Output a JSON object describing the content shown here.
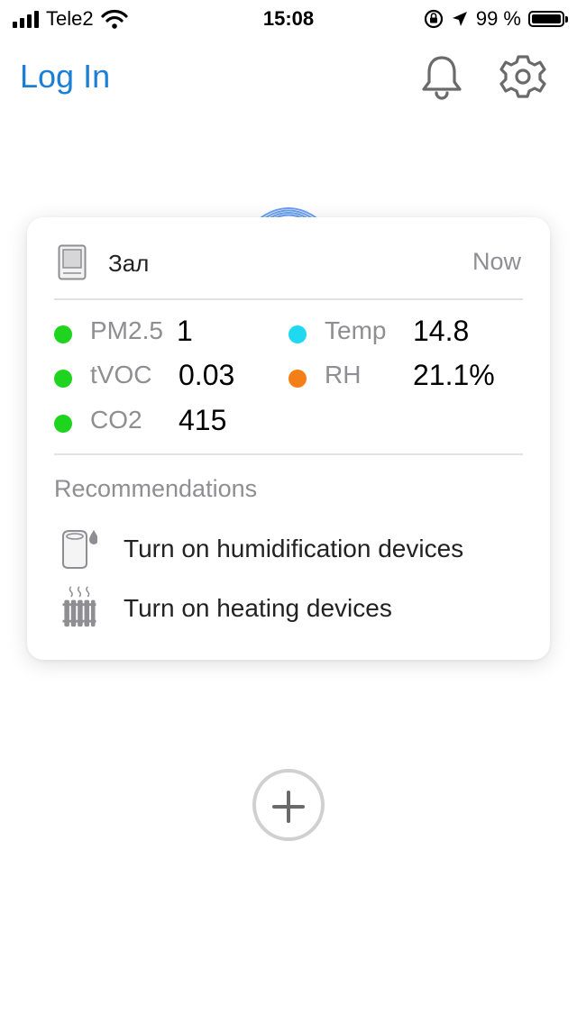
{
  "status_bar": {
    "carrier": "Tele2",
    "time": "15:08",
    "battery": "99 %"
  },
  "header": {
    "login_label": "Log In",
    "bell_icon": "bell-icon",
    "settings_icon": "gear-icon",
    "accent_color": "#1a7fd6"
  },
  "card": {
    "device_icon": "air-monitor-icon",
    "room_name": "Зал",
    "updated": "Now",
    "metrics": [
      {
        "label": "PM2.5",
        "value": "1",
        "color": "#1ed41e"
      },
      {
        "label": "tVOC",
        "value": "0.03",
        "color": "#1ed41e"
      },
      {
        "label": "CO2",
        "value": "415",
        "color": "#1ed41e"
      },
      {
        "label": "Temp",
        "value": "14.8",
        "color": "#20d8f0"
      },
      {
        "label": "RH",
        "value": "21.1%",
        "color": "#f57f17"
      }
    ],
    "recommendations_title": "Recommendations",
    "recommendations": [
      {
        "icon": "humidifier-icon",
        "text": "Turn on humidification devices"
      },
      {
        "icon": "radiator-icon",
        "text": "Turn on heating devices"
      }
    ]
  },
  "add_button_icon": "plus-icon"
}
